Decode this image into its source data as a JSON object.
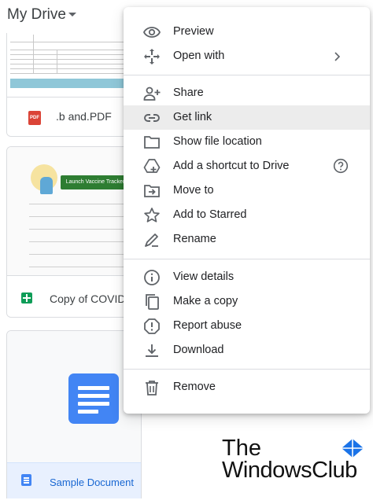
{
  "header": {
    "title": "My Drive"
  },
  "files": [
    {
      "name": ".b and.PDF",
      "type_badge": "PDF",
      "icon": "pdf-icon"
    },
    {
      "name": "Copy of COVID-1",
      "thumb_button": "Launch Vaccine Tracker",
      "icon": "sheets-icon"
    },
    {
      "name": "Sample Document",
      "icon": "docs-icon"
    }
  ],
  "menu": {
    "items": [
      {
        "label": "Preview",
        "icon": "eye-icon"
      },
      {
        "label": "Open with",
        "icon": "open-with-icon",
        "trailing": "chevron-right-icon"
      },
      {
        "label": "Share",
        "icon": "person-add-icon"
      },
      {
        "label": "Get link",
        "icon": "link-icon",
        "active": true
      },
      {
        "label": "Show file location",
        "icon": "folder-icon"
      },
      {
        "label": "Add a shortcut to Drive",
        "icon": "add-shortcut-icon",
        "trailing": "help-icon"
      },
      {
        "label": "Move to",
        "icon": "move-to-icon"
      },
      {
        "label": "Add to Starred",
        "icon": "star-icon"
      },
      {
        "label": "Rename",
        "icon": "rename-icon"
      },
      {
        "label": "View details",
        "icon": "info-icon"
      },
      {
        "label": "Make a copy",
        "icon": "copy-icon"
      },
      {
        "label": "Report abuse",
        "icon": "report-icon"
      },
      {
        "label": "Download",
        "icon": "download-icon"
      },
      {
        "label": "Remove",
        "icon": "trash-icon"
      }
    ]
  },
  "watermark": {
    "line1": "The",
    "line2": "WindowsClub"
  },
  "colors": {
    "hover": "#ececec",
    "icon": "#5f6368",
    "sheets_green": "#0f9d58",
    "docs_blue": "#4285f4",
    "pdf_red": "#db4437",
    "selected_file_bg": "#e8f0fe"
  }
}
